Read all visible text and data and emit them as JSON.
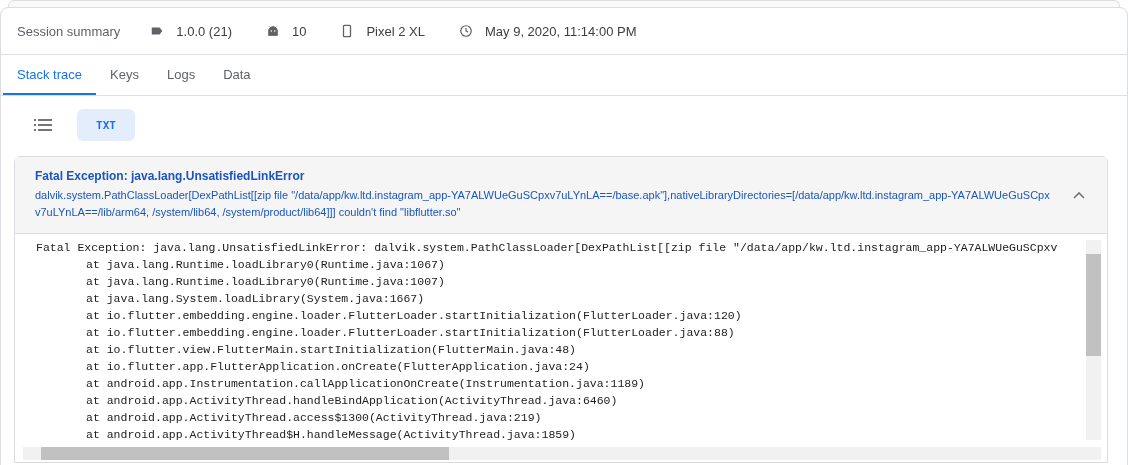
{
  "summary": {
    "title": "Session summary",
    "items": [
      {
        "kind": "version",
        "text": "1.0.0 (21)"
      },
      {
        "kind": "android",
        "text": "10"
      },
      {
        "kind": "device",
        "text": "Pixel 2 XL"
      },
      {
        "kind": "time",
        "text": "May 9, 2020, 11:14:00 PM"
      }
    ]
  },
  "tabs": [
    {
      "label": "Stack trace",
      "selected": true
    },
    {
      "label": "Keys",
      "selected": false
    },
    {
      "label": "Logs",
      "selected": false
    },
    {
      "label": "Data",
      "selected": false
    }
  ],
  "view_toggle": [
    {
      "kind": "list",
      "selected": false
    },
    {
      "kind": "text",
      "label": "TXT",
      "selected": true
    }
  ],
  "exception": {
    "title": "Fatal Exception: java.lang.UnsatisfiedLinkError",
    "message": "dalvik.system.PathClassLoader[DexPathList[[zip file \"/data/app/kw.ltd.instagram_app-YA7ALWUeGuSCpxv7uLYnLA==/base.apk\"],nativeLibraryDirectories=[/data/app/kw.ltd.instagram_app-YA7ALWUeGuSCpxv7uLYnLA==/lib/arm64, /system/lib64, /system/product/lib64]]] couldn't find \"libflutter.so\"",
    "expanded": true,
    "trace": [
      {
        "kind": "header",
        "text": "Fatal Exception: java.lang.UnsatisfiedLinkError: dalvik.system.PathClassLoader[DexPathList[[zip file \"/data/app/kw.ltd.instagram_app-YA7ALWUeGuSCpxv"
      },
      {
        "kind": "frame",
        "text": "at java.lang.Runtime.loadLibrary0(Runtime.java:1067)"
      },
      {
        "kind": "frame",
        "text": "at java.lang.Runtime.loadLibrary0(Runtime.java:1007)"
      },
      {
        "kind": "frame",
        "text": "at java.lang.System.loadLibrary(System.java:1667)"
      },
      {
        "kind": "frame",
        "text": "at io.flutter.embedding.engine.loader.FlutterLoader.startInitialization(FlutterLoader.java:120)"
      },
      {
        "kind": "frame",
        "text": "at io.flutter.embedding.engine.loader.FlutterLoader.startInitialization(FlutterLoader.java:88)"
      },
      {
        "kind": "frame",
        "text": "at io.flutter.view.FlutterMain.startInitialization(FlutterMain.java:48)"
      },
      {
        "kind": "frame",
        "text": "at io.flutter.app.FlutterApplication.onCreate(FlutterApplication.java:24)"
      },
      {
        "kind": "frame",
        "text": "at android.app.Instrumentation.callApplicationOnCreate(Instrumentation.java:1189)"
      },
      {
        "kind": "frame",
        "text": "at android.app.ActivityThread.handleBindApplication(ActivityThread.java:6460)"
      },
      {
        "kind": "frame",
        "text": "at android.app.ActivityThread.access$1300(ActivityThread.java:219)"
      },
      {
        "kind": "frame",
        "text": "at android.app.ActivityThread$H.handleMessage(ActivityThread.java:1859)"
      }
    ]
  }
}
